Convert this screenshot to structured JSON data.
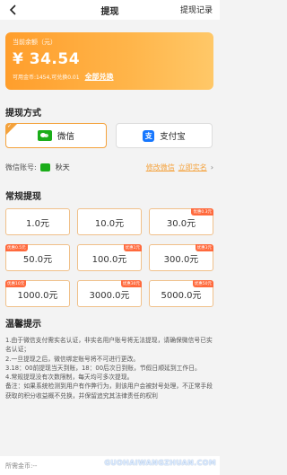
{
  "header": {
    "title": "提现",
    "record_link": "提现记录"
  },
  "balance": {
    "label": "当前余额（元）",
    "amount": "¥ 34.54",
    "coins_info": "可用金币:1454,可兑换0.01",
    "redeem_all": "全部兑换"
  },
  "method_section": {
    "title": "提现方式",
    "options": [
      {
        "label": "微信",
        "selected": true
      },
      {
        "label": "支付宝",
        "selected": false
      }
    ]
  },
  "account": {
    "label": "微信账号:",
    "name": "秋天",
    "edit_link": "修改微信",
    "verify_link": "立即实名"
  },
  "regular_section": {
    "title": "常规提现",
    "amounts": [
      {
        "label": "1.0元",
        "tag": ""
      },
      {
        "label": "10.0元",
        "tag": ""
      },
      {
        "label": "30.0元",
        "tag": "优惠0.3元"
      },
      {
        "label": "50.0元",
        "tag": "优惠0.5元"
      },
      {
        "label": "100.0元",
        "tag": "优惠1元"
      },
      {
        "label": "300.0元",
        "tag": "优惠3元"
      },
      {
        "label": "1000.0元",
        "tag": "优惠10元"
      },
      {
        "label": "3000.0元",
        "tag": "优惠30元"
      },
      {
        "label": "5000.0元",
        "tag": "优惠50元"
      }
    ]
  },
  "tips": {
    "title": "温馨提示",
    "lines": [
      "1.由于微信支付需实名认证，非实名用户账号将无法提现，请确保微信号已实名认证；",
      "2.一旦提现之后，微信绑定账号将不可进行更改。",
      "3.18：00前提现当天到账，18：00后次日到账，节假日顺延到工作日。",
      "4.常规提现没有次数限制，每天均可多次提现。",
      "备注：如果系统检测到用户有作弊行为，则该用户会被封号处理，不正常手段获取的积分收益概不兑换，并保留追究其法律责任的权利"
    ]
  },
  "footer": {
    "text": "所需金币:--"
  },
  "watermark": "GUOHAIWANGZHUAN.COM"
}
